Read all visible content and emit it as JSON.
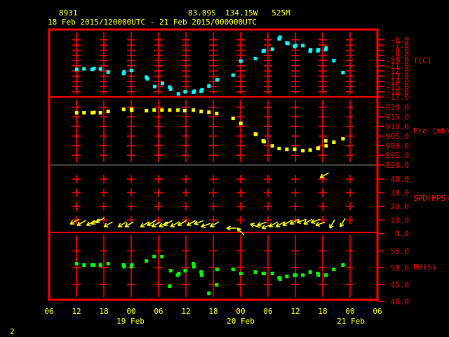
{
  "header": {
    "station": "8931",
    "location": "83.89S  134.15W   525M",
    "period": "18 Feb 2015/120000UTC - 21 Feb 2015/000000UTC"
  },
  "page_number": "2",
  "colors": {
    "axis": "#ff0000",
    "temp": "#00ffff",
    "pres": "#ffff00",
    "wind": "#ffff00",
    "rh": "#00ff00",
    "text": "#ffff00"
  },
  "chart_data": [
    {
      "type": "scatter",
      "title": "T(C)",
      "ylabel": "T(C)",
      "ylim": [
        -17,
        -6
      ],
      "yticks": [
        "-6.0",
        "-7.0",
        "-8.0",
        "-9.0",
        "-10.0",
        "-11.0",
        "-12.0",
        "-13.0",
        "-14.0",
        "-15.0",
        "-16.0",
        "-17.0"
      ],
      "x_units": "hours since 18 Feb 12UTC",
      "points": [
        [
          0.2,
          -11.7
        ],
        [
          1.8,
          -11.6
        ],
        [
          3.6,
          -11.7
        ],
        [
          4,
          -11.5
        ],
        [
          5.4,
          -11.6
        ],
        [
          7.1,
          -12.2
        ],
        [
          10.5,
          -12.5
        ],
        [
          10.6,
          -12.2
        ],
        [
          12.2,
          -11.9
        ],
        [
          15.5,
          -13.2
        ],
        [
          15.7,
          -13.5
        ],
        [
          17.3,
          -15
        ],
        [
          19,
          -14.4
        ],
        [
          20.6,
          -15.1
        ],
        [
          20.8,
          -15.5
        ],
        [
          22.5,
          -16.4
        ],
        [
          24,
          -16
        ],
        [
          25.8,
          -16.1
        ],
        [
          26,
          -15.9
        ],
        [
          27.5,
          -15.9
        ],
        [
          27.7,
          -15.6
        ],
        [
          29.2,
          -14.9
        ],
        [
          31,
          -13.7
        ],
        [
          34.5,
          -12.8
        ],
        [
          36.2,
          -10.1
        ],
        [
          39.4,
          -9.6
        ],
        [
          41.1,
          -8.2
        ],
        [
          41.3,
          -8.1
        ],
        [
          43.1,
          -7.8
        ],
        [
          44.6,
          -5.8
        ],
        [
          44.8,
          -5.5
        ],
        [
          46.3,
          -6.6
        ],
        [
          46.5,
          -6.7
        ],
        [
          48,
          -7.3
        ],
        [
          48.2,
          -7.1
        ],
        [
          49.8,
          -7.1
        ],
        [
          51.4,
          -8.2
        ],
        [
          51.5,
          -7.9
        ],
        [
          53.1,
          -8.1
        ],
        [
          53.2,
          -7.9
        ],
        [
          54.8,
          -7.9
        ],
        [
          54.9,
          -7.6
        ],
        [
          56.6,
          -10
        ],
        [
          58.6,
          -12.3
        ]
      ]
    },
    {
      "type": "scatter",
      "title": "Pre (mb)",
      "ylabel": "Pre (mb)",
      "ylim": [
        890,
        920
      ],
      "yticks": [
        "920.0",
        "915.0",
        "910.0",
        "905.0",
        "900.0",
        "895.0",
        "890.0"
      ],
      "points": [
        [
          0.2,
          917.1
        ],
        [
          1.8,
          917.1
        ],
        [
          3.6,
          917.1
        ],
        [
          4,
          917.3
        ],
        [
          5.4,
          917.1
        ],
        [
          7.1,
          917.8
        ],
        [
          10.5,
          918.9
        ],
        [
          12.2,
          918.9
        ],
        [
          12.3,
          918.4
        ],
        [
          15.5,
          918.2
        ],
        [
          17.2,
          918.5
        ],
        [
          18.9,
          918.5
        ],
        [
          20.6,
          918.5
        ],
        [
          22.4,
          918.5
        ],
        [
          23.9,
          918.2
        ],
        [
          25.8,
          918.5
        ],
        [
          27.5,
          917.8
        ],
        [
          29.2,
          917.4
        ],
        [
          30.9,
          916.7
        ],
        [
          34.5,
          914.2
        ],
        [
          36.2,
          911.6
        ],
        [
          39.4,
          906.1
        ],
        [
          39.5,
          905.8
        ],
        [
          41.1,
          902.5
        ],
        [
          41.3,
          902.1
        ],
        [
          43.1,
          899.9
        ],
        [
          44.6,
          898.5
        ],
        [
          46.3,
          898.1
        ],
        [
          48,
          898.1
        ],
        [
          49.8,
          897.4
        ],
        [
          51.4,
          897.7
        ],
        [
          53.1,
          898.5
        ],
        [
          53.2,
          898.8
        ],
        [
          54.8,
          902.5
        ],
        [
          54.9,
          899.9
        ],
        [
          56.6,
          901.8
        ],
        [
          58.6,
          903.6
        ]
      ]
    },
    {
      "type": "vector",
      "title": "SPD(MPS)",
      "ylabel": "SPD(MPS)",
      "ylim": [
        0,
        40
      ],
      "yticks": [
        "40.0",
        "30.0",
        "20.0",
        "10.0",
        "0.0"
      ],
      "points_hour_speed_arrowdir": [
        [
          -1.2,
          7,
          150
        ],
        [
          0.3,
          6,
          150
        ],
        [
          2.4,
          6,
          150
        ],
        [
          3.4,
          7,
          150
        ],
        [
          4.4,
          8,
          150
        ],
        [
          6.2,
          5,
          150
        ],
        [
          9.3,
          5,
          150
        ],
        [
          10.8,
          5,
          150
        ],
        [
          14.2,
          5,
          150
        ],
        [
          15.7,
          6,
          150
        ],
        [
          16.7,
          5,
          150
        ],
        [
          18.3,
          5,
          150
        ],
        [
          19.3,
          6,
          150
        ],
        [
          20.8,
          5,
          150
        ],
        [
          22.4,
          6,
          150
        ],
        [
          24.4,
          6,
          150
        ],
        [
          26,
          7,
          160
        ],
        [
          27.5,
          5,
          160
        ],
        [
          29.5,
          5,
          150
        ],
        [
          33.1,
          4,
          180
        ],
        [
          35.4,
          4,
          225
        ],
        [
          38.3,
          7,
          200
        ],
        [
          39.8,
          6,
          160
        ],
        [
          40.8,
          4,
          160
        ],
        [
          42.4,
          5,
          150
        ],
        [
          43.9,
          5,
          150
        ],
        [
          45.4,
          6,
          150
        ],
        [
          47,
          7,
          150
        ],
        [
          48.5,
          8,
          160
        ],
        [
          50,
          7,
          150
        ],
        [
          51.6,
          8,
          160
        ],
        [
          52.6,
          6,
          160
        ],
        [
          53.6,
          41,
          150
        ],
        [
          55.7,
          4,
          120
        ],
        [
          58,
          5,
          120
        ]
      ]
    },
    {
      "type": "scatter",
      "title": "RH(%)",
      "ylabel": "RH(%)",
      "ylim": [
        40,
        55
      ],
      "yticks": [
        "55.0",
        "50.0",
        "45.0",
        "40.0"
      ],
      "points": [
        [
          0.2,
          51.2
        ],
        [
          1.8,
          50.8
        ],
        [
          3.6,
          50.8
        ],
        [
          4,
          50.8
        ],
        [
          5.4,
          50.8
        ],
        [
          7.1,
          51.2
        ],
        [
          10.5,
          50.8
        ],
        [
          10.6,
          50.3
        ],
        [
          12.2,
          50.3
        ],
        [
          12.3,
          50.8
        ],
        [
          15.5,
          52
        ],
        [
          17.2,
          53.3
        ],
        [
          18.9,
          53.3
        ],
        [
          20.6,
          44.5
        ],
        [
          20.8,
          49.1
        ],
        [
          22.3,
          47.8
        ],
        [
          22.6,
          48.3
        ],
        [
          24,
          49.1
        ],
        [
          25.8,
          51.2
        ],
        [
          25.9,
          50.3
        ],
        [
          27.5,
          48.7
        ],
        [
          27.6,
          47.8
        ],
        [
          29.2,
          42.4
        ],
        [
          30.9,
          44.9
        ],
        [
          31,
          49.5
        ],
        [
          34.5,
          49.5
        ],
        [
          36.2,
          48.3
        ],
        [
          39.4,
          48.7
        ],
        [
          41.1,
          48.3
        ],
        [
          41.3,
          48.3
        ],
        [
          43.1,
          48.3
        ],
        [
          44.6,
          47
        ],
        [
          44.8,
          46.6
        ],
        [
          46.3,
          47.4
        ],
        [
          48,
          47.8
        ],
        [
          48.2,
          47.8
        ],
        [
          49.8,
          47.8
        ],
        [
          51.4,
          48.7
        ],
        [
          53.1,
          48.3
        ],
        [
          53.2,
          47.8
        ],
        [
          54.8,
          47.8
        ],
        [
          54.9,
          47.8
        ],
        [
          56.6,
          49.5
        ],
        [
          58.6,
          50.8
        ]
      ]
    }
  ],
  "x_axis": {
    "tick_labels": [
      "06",
      "12",
      "18",
      "00",
      "06",
      "12",
      "18",
      "00",
      "06",
      "12",
      "18",
      "00",
      "06"
    ],
    "date_labels": [
      "19 Feb",
      "20 Feb",
      "21 Feb"
    ]
  }
}
